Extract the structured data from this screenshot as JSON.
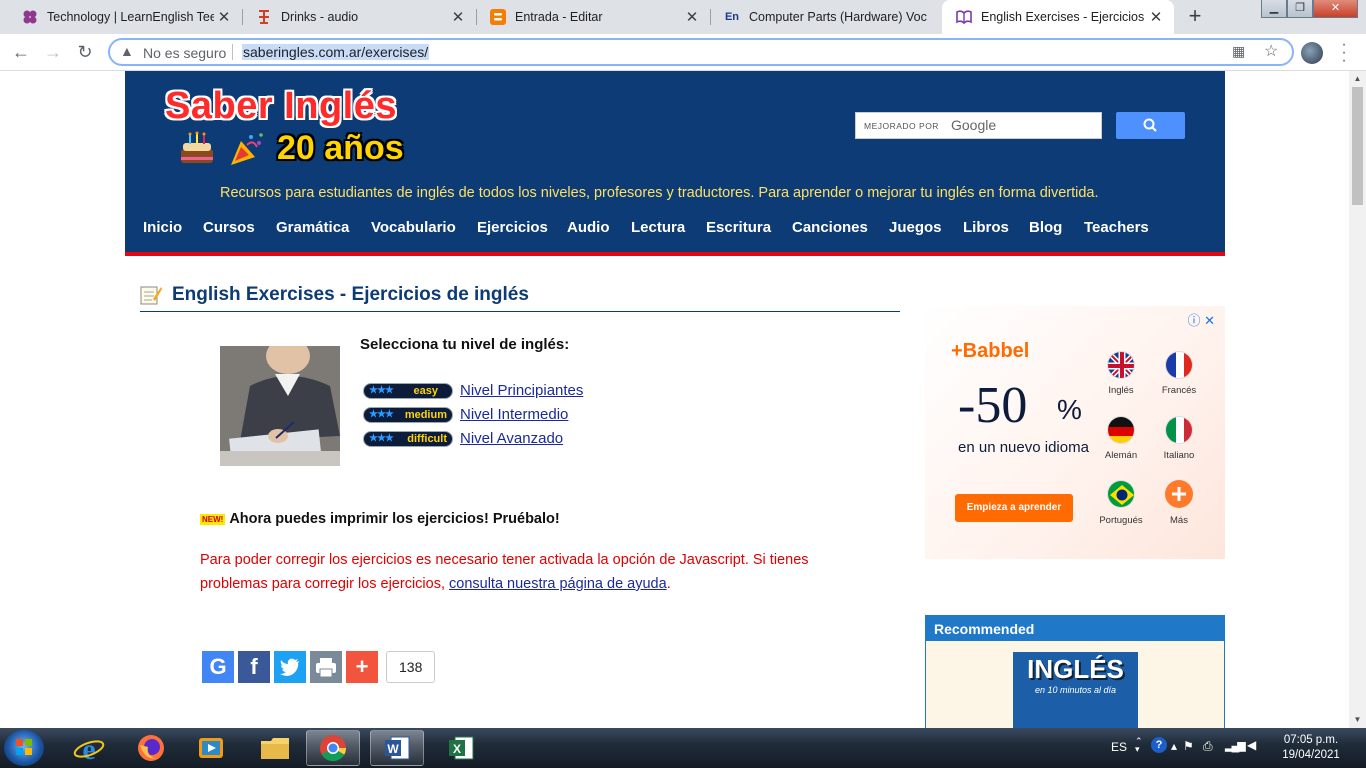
{
  "browser": {
    "tabs": [
      {
        "title": "Technology | LearnEnglish Teens",
        "favicon": "four-petal-icon",
        "active": false
      },
      {
        "title": "Drinks - audio",
        "favicon": "flashcards-icon",
        "active": false
      },
      {
        "title": "Entrada - Editar",
        "favicon": "blogger-icon",
        "active": false
      },
      {
        "title": "Computer Parts (Hardware) Voc",
        "favicon": "en-badge-icon",
        "active": false
      },
      {
        "title": "English Exercises - Ejercicios de",
        "favicon": "book-icon",
        "active": true
      }
    ],
    "address": {
      "security_label": "No es seguro",
      "url": "saberingles.com.ar/exercises/"
    },
    "accent_color": "#8ab4f8"
  },
  "site": {
    "logo_title": "Saber Inglés",
    "anniversary": "20 años",
    "tagline": "Recursos para estudiantes de inglés de todos los niveles, profesores y traductores. Para aprender o mejorar tu inglés en forma divertida.",
    "search": {
      "prefix": "MEJORADO POR",
      "brand": "Google"
    },
    "nav": [
      "Inicio",
      "Cursos",
      "Gramática",
      "Vocabulario",
      "Ejercicios",
      "Audio",
      "Lectura",
      "Escritura",
      "Canciones",
      "Juegos",
      "Libros",
      "Blog",
      "Teachers"
    ],
    "colors": {
      "header_bg": "#0c3b75",
      "header_border": "#e30613",
      "tagline": "#ffe066"
    }
  },
  "content": {
    "heading": "English Exercises - Ejercicios de inglés",
    "level_prompt": "Selecciona tu nivel de inglés:",
    "levels": [
      {
        "badge": "easy",
        "stars": "★★★",
        "link": "Nivel Principiantes"
      },
      {
        "badge": "medium",
        "stars": "★★★",
        "link": "Nivel Intermedio"
      },
      {
        "badge": "difficult",
        "stars": "★★★",
        "link": "Nivel Avanzado"
      }
    ],
    "new_badge": "NEW!",
    "new_text": "Ahora puedes imprimir los ejercicios! Pruébalo!",
    "js_note": "Para poder corregir los ejercicios es necesario tener activada la opción de Javascript. Si tienes problemas para corregir los ejercicios, ",
    "js_link": "consulta nuestra página de ayuda",
    "js_end": ".",
    "share_count": "138"
  },
  "ad": {
    "brand": "+Babbel",
    "discount": "-50",
    "percent": "%",
    "subtitle": "en un nuevo idioma",
    "cta": "Empieza a aprender",
    "languages": [
      "Inglés",
      "Francés",
      "Alemán",
      "Italiano",
      "Portugués",
      "Más"
    ]
  },
  "recommended": {
    "title": "Recommended",
    "book_title": "INGLÉS",
    "book_subtitle": "en 10 minutos al día"
  },
  "taskbar": {
    "language": "ES",
    "time": "07:05 p.m.",
    "date": "19/04/2021"
  }
}
